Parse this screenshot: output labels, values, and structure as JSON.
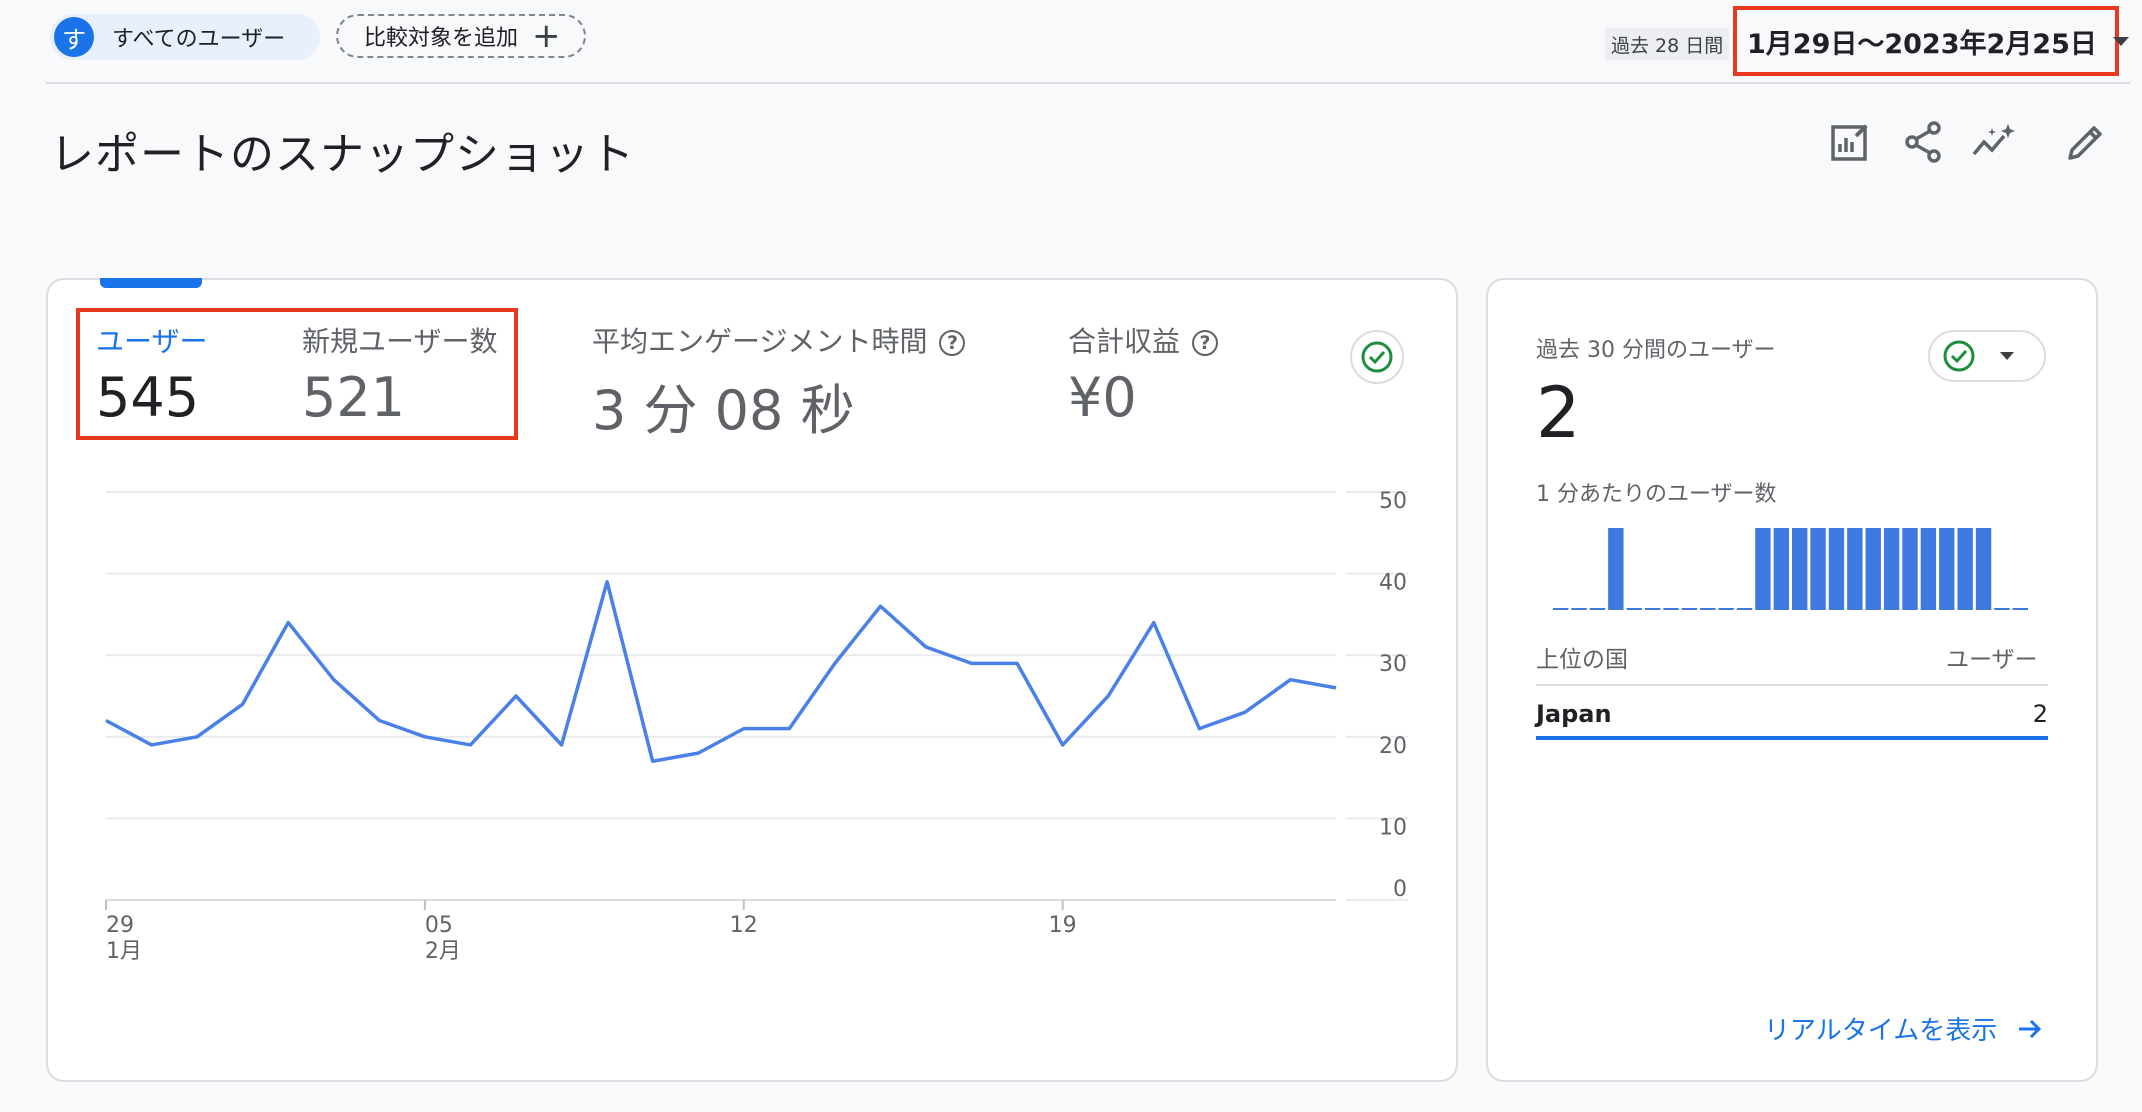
{
  "segment": {
    "avatar": "す",
    "label": "すべてのユーザー"
  },
  "compare": {
    "label": "比較対象を追加",
    "icon": "plus-icon"
  },
  "date_range": {
    "period_label": "過去 28 日間",
    "range": "1月29日〜2023年2月25日"
  },
  "page": {
    "title": "レポートのスナップショット"
  },
  "toolbar": {
    "icons": [
      "customize-report-icon",
      "share-icon",
      "insights-icon",
      "edit-icon"
    ]
  },
  "kpis": {
    "users": {
      "label": "ユーザー",
      "value": "545"
    },
    "new_users": {
      "label": "新規ユーザー数",
      "value": "521"
    },
    "engagement": {
      "label": "平均エンゲージメント時間",
      "value": "3 分 08 秒"
    },
    "revenue": {
      "label": "合計収益",
      "value": "¥0"
    }
  },
  "chart_data": {
    "type": "line",
    "x": [
      "1月29日",
      "1月30日",
      "1月31日",
      "2月1日",
      "2月2日",
      "2月3日",
      "2月4日",
      "2月5日",
      "2月6日",
      "2月7日",
      "2月8日",
      "2月9日",
      "2月10日",
      "2月11日",
      "2月12日",
      "2月13日",
      "2月14日",
      "2月15日",
      "2月16日",
      "2月17日",
      "2月18日",
      "2月19日",
      "2月20日",
      "2月21日",
      "2月22日",
      "2月23日",
      "2月24日",
      "2月25日"
    ],
    "x_ticks": [
      {
        "day": "29",
        "month": "1月",
        "index": 0
      },
      {
        "day": "05",
        "month": "2月",
        "index": 7
      },
      {
        "day": "12",
        "month": "",
        "index": 14
      },
      {
        "day": "19",
        "month": "",
        "index": 21
      }
    ],
    "series": [
      {
        "values": [
          22,
          19,
          20,
          24,
          34,
          27,
          22,
          20,
          19,
          25,
          19,
          39,
          17,
          18,
          21,
          21,
          29,
          36,
          31,
          29,
          29,
          19,
          25,
          34,
          21,
          23,
          27,
          26
        ]
      }
    ],
    "ylim": [
      0,
      50
    ],
    "yticks": [
      "50",
      "40",
      "30",
      "20",
      "10",
      "0"
    ],
    "grid": true,
    "colors": {
      "line": "#4a80e8"
    }
  },
  "realtime": {
    "title": "過去 30 分間のユーザー",
    "value": "2",
    "per_minute_label": "1 分あたりのユーザー数",
    "bars": [
      0,
      0,
      0,
      1,
      0,
      0,
      0,
      0,
      0,
      0,
      0,
      1,
      1,
      1,
      1,
      1,
      1,
      1,
      1,
      1,
      1,
      1,
      1,
      1,
      0,
      0
    ],
    "top_header": "上位の国",
    "users_header": "ユーザー",
    "rows": [
      {
        "country": "Japan",
        "users": "2"
      }
    ],
    "link": "リアルタイムを表示"
  },
  "colors": {
    "accent": "#1a73e8",
    "highlight": "#e8381f",
    "check": "#1e8e3e"
  }
}
